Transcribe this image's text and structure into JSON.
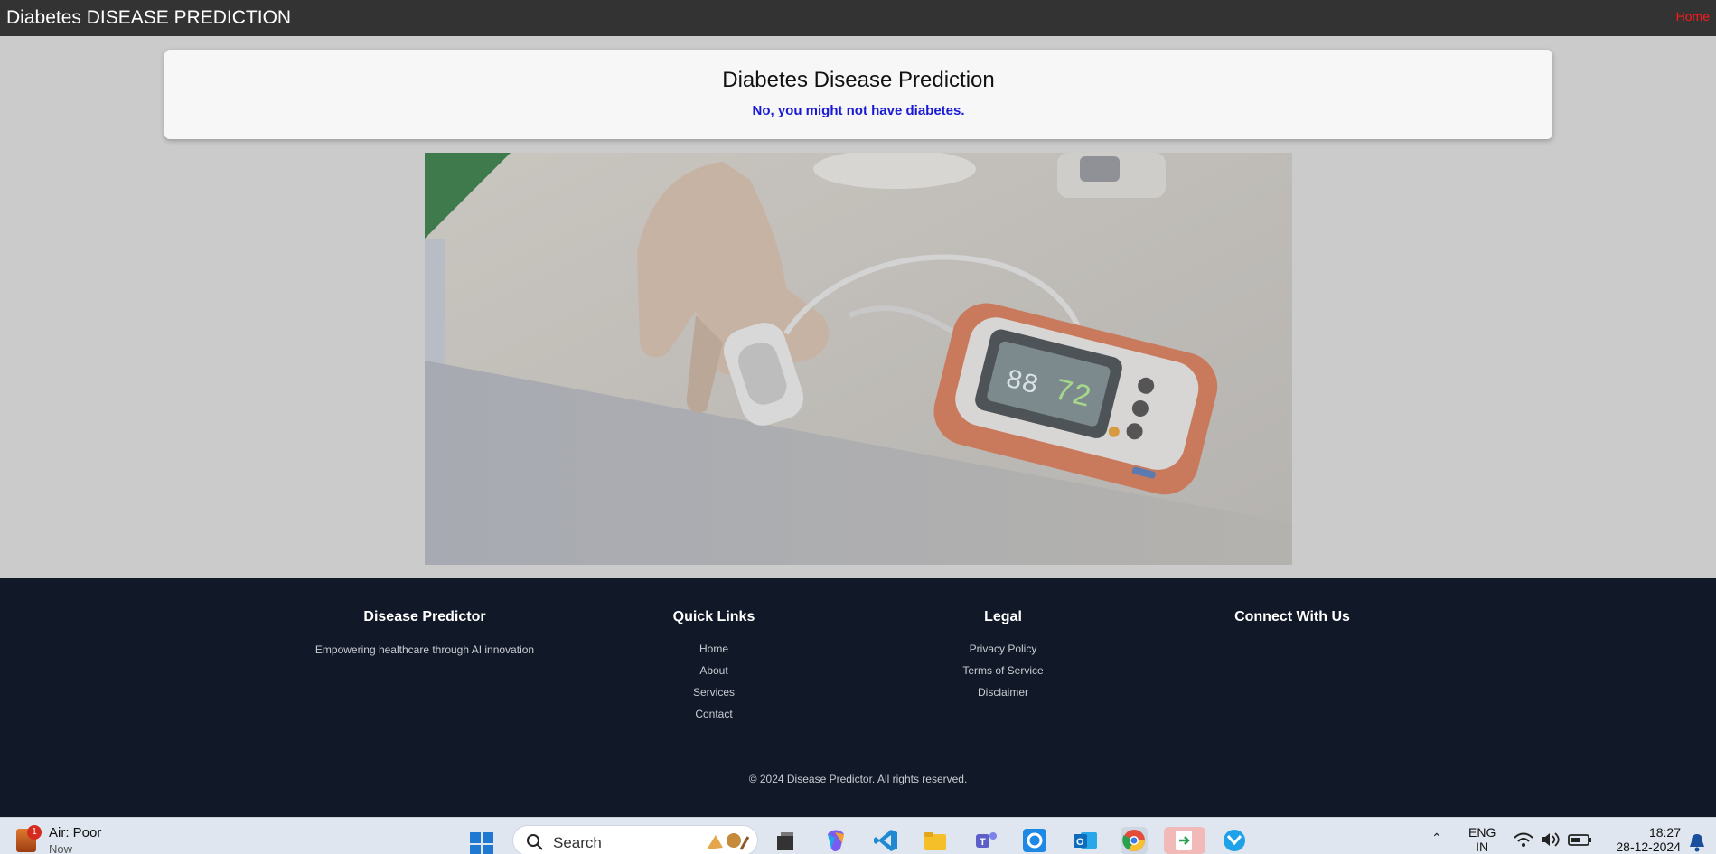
{
  "nav": {
    "brand": "Diabetes DISEASE PREDICTION",
    "home_link": "Home"
  },
  "result": {
    "title": "Diabetes Disease Prediction",
    "message": "No, you might not have diabetes."
  },
  "footer": {
    "about": {
      "heading": "Disease Predictor",
      "tagline": "Empowering healthcare through AI innovation"
    },
    "quick_links": {
      "heading": "Quick Links",
      "items": [
        "Home",
        "About",
        "Services",
        "Contact"
      ]
    },
    "legal": {
      "heading": "Legal",
      "items": [
        "Privacy Policy",
        "Terms of Service",
        "Disclaimer"
      ]
    },
    "connect": {
      "heading": "Connect With Us"
    },
    "copyright": "© 2024 Disease Predictor. All rights reserved."
  },
  "taskbar": {
    "weather": {
      "badge": "1",
      "label": "Air: Poor",
      "sub": "Now"
    },
    "search_placeholder": "Search",
    "apps": [
      "task-view",
      "copilot",
      "vscode",
      "file-explorer",
      "teams",
      "cortana",
      "outlook",
      "chrome",
      "file-transfer",
      "edge-bing"
    ],
    "language": "ENG",
    "region": "IN",
    "time": "18:27",
    "date": "28-12-2024"
  },
  "colors": {
    "topbar": "#333333",
    "home_link": "#ff1a1a",
    "result_text": "#1a1ad6",
    "footer_bg": "#111827",
    "page_bg": "#cbcbcb"
  }
}
